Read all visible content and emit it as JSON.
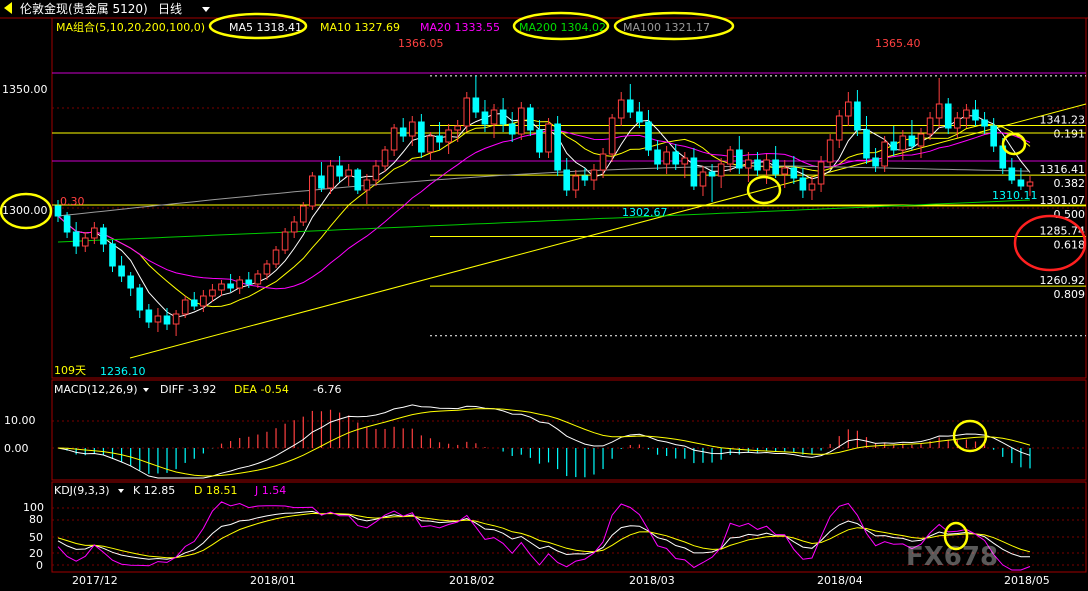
{
  "header": {
    "back_icon": "left-triangle-icon",
    "instrument": "伦敦金现(贵金属 5120)",
    "period": "日线",
    "dropdown_icon": "chevron-down-icon"
  },
  "ma_legend": {
    "label": "MA组合(5,10,20,200,100,0)",
    "items": [
      {
        "text": "MA5 1318.41",
        "color": "#ffffff"
      },
      {
        "text": "MA10 1327.69",
        "color": "#ffff00"
      },
      {
        "text": "MA20 1333.55",
        "color": "#ff00ff"
      },
      {
        "text": "MA200 1304.02",
        "color": "#00cc00"
      },
      {
        "text": "MA100 1321.17",
        "color": "#999999"
      }
    ]
  },
  "price_axis": {
    "ticks": [
      "1350.00",
      "1300.00"
    ],
    "min": 1225,
    "max": 1375
  },
  "annotations": {
    "high_left": "1366.05",
    "high_right": "1365.40",
    "low_left": "1236.10",
    "low_mid": "1302.67",
    "low_right": "1310.11",
    "left_partial": "0.30",
    "days": "109天"
  },
  "fib_levels": [
    {
      "price": "1341.23",
      "ratio": "0.191"
    },
    {
      "price": "1316.41",
      "ratio": "0.382"
    },
    {
      "price": "1301.07",
      "ratio": "0.500"
    },
    {
      "price": "1285.74",
      "ratio": "0.618"
    },
    {
      "price": "1260.92",
      "ratio": "0.809"
    }
  ],
  "macd_legend": {
    "label": "MACD(12,26,9)",
    "diff": "DIFF -3.92",
    "dea": "DEA -0.54",
    "macd": "-6.76",
    "ticks": [
      "10.00",
      "0.00"
    ]
  },
  "kdj_legend": {
    "label": "KDJ(9,3,3)",
    "k": "K 12.85",
    "d": "D 18.51",
    "j": "J 1.54",
    "ticks": [
      "100",
      "80",
      "50",
      "20",
      "0"
    ]
  },
  "time_axis": [
    "2017/12",
    "2018/01",
    "2018/02",
    "2018/03",
    "2018/04",
    "2018/05"
  ],
  "watermark": "FX678",
  "colors": {
    "up": "#ff4040",
    "down": "#00ffff",
    "ma5": "#ffffff",
    "ma10": "#ffff00",
    "ma20": "#ff00ff",
    "ma200": "#00cc00",
    "ma100": "#9a9a9a",
    "fib": "#ffff00",
    "highlight": "#ffff00",
    "circle_red": "#ff2020",
    "grid": "#7a0000"
  },
  "chart_data": {
    "type": "candlestick",
    "ohlc": [
      [
        1301,
        1304,
        1293,
        1296
      ],
      [
        1296,
        1298,
        1285,
        1288
      ],
      [
        1288,
        1293,
        1277,
        1281
      ],
      [
        1281,
        1288,
        1278,
        1285
      ],
      [
        1285,
        1293,
        1282,
        1290
      ],
      [
        1290,
        1292,
        1278,
        1282
      ],
      [
        1282,
        1284,
        1268,
        1271
      ],
      [
        1271,
        1276,
        1263,
        1266
      ],
      [
        1266,
        1268,
        1256,
        1260
      ],
      [
        1260,
        1262,
        1245,
        1249
      ],
      [
        1249,
        1252,
        1240,
        1243
      ],
      [
        1243,
        1250,
        1238,
        1246
      ],
      [
        1246,
        1250,
        1239,
        1242
      ],
      [
        1242,
        1249,
        1236,
        1247
      ],
      [
        1247,
        1256,
        1245,
        1254
      ],
      [
        1254,
        1258,
        1249,
        1251
      ],
      [
        1251,
        1259,
        1248,
        1256
      ],
      [
        1256,
        1262,
        1253,
        1259
      ],
      [
        1259,
        1264,
        1256,
        1262
      ],
      [
        1262,
        1267,
        1258,
        1260
      ],
      [
        1260,
        1266,
        1257,
        1264
      ],
      [
        1264,
        1268,
        1260,
        1262
      ],
      [
        1262,
        1269,
        1260,
        1267
      ],
      [
        1267,
        1274,
        1264,
        1272
      ],
      [
        1272,
        1281,
        1270,
        1279
      ],
      [
        1279,
        1290,
        1277,
        1288
      ],
      [
        1288,
        1296,
        1285,
        1293
      ],
      [
        1293,
        1303,
        1291,
        1301
      ],
      [
        1301,
        1318,
        1299,
        1316
      ],
      [
        1316,
        1323,
        1308,
        1310
      ],
      [
        1310,
        1324,
        1307,
        1321
      ],
      [
        1321,
        1326,
        1313,
        1316
      ],
      [
        1316,
        1322,
        1311,
        1319
      ],
      [
        1319,
        1320,
        1307,
        1309
      ],
      [
        1309,
        1317,
        1302,
        1314
      ],
      [
        1314,
        1324,
        1311,
        1321
      ],
      [
        1321,
        1331,
        1318,
        1329
      ],
      [
        1329,
        1342,
        1326,
        1340
      ],
      [
        1340,
        1345,
        1333,
        1336
      ],
      [
        1336,
        1346,
        1331,
        1343
      ],
      [
        1343,
        1347,
        1325,
        1328
      ],
      [
        1328,
        1338,
        1324,
        1336
      ],
      [
        1336,
        1343,
        1329,
        1333
      ],
      [
        1333,
        1342,
        1327,
        1339
      ],
      [
        1339,
        1344,
        1333,
        1341
      ],
      [
        1341,
        1358,
        1338,
        1355
      ],
      [
        1355,
        1366,
        1345,
        1348
      ],
      [
        1348,
        1354,
        1338,
        1342
      ],
      [
        1342,
        1352,
        1335,
        1349
      ],
      [
        1349,
        1355,
        1338,
        1342
      ],
      [
        1342,
        1348,
        1333,
        1337
      ],
      [
        1337,
        1353,
        1334,
        1350
      ],
      [
        1350,
        1352,
        1336,
        1339
      ],
      [
        1339,
        1344,
        1325,
        1328
      ],
      [
        1328,
        1345,
        1325,
        1342
      ],
      [
        1342,
        1346,
        1316,
        1319
      ],
      [
        1319,
        1325,
        1306,
        1309
      ],
      [
        1309,
        1319,
        1305,
        1316
      ],
      [
        1316,
        1320,
        1311,
        1314
      ],
      [
        1314,
        1322,
        1309,
        1319
      ],
      [
        1319,
        1330,
        1315,
        1327
      ],
      [
        1327,
        1347,
        1323,
        1345
      ],
      [
        1345,
        1358,
        1341,
        1354
      ],
      [
        1354,
        1362,
        1345,
        1348
      ],
      [
        1348,
        1353,
        1340,
        1343
      ],
      [
        1343,
        1349,
        1326,
        1329
      ],
      [
        1329,
        1334,
        1319,
        1322
      ],
      [
        1322,
        1331,
        1317,
        1328
      ],
      [
        1328,
        1332,
        1319,
        1322
      ],
      [
        1322,
        1328,
        1315,
        1325
      ],
      [
        1325,
        1330,
        1309,
        1311
      ],
      [
        1311,
        1321,
        1306,
        1318
      ],
      [
        1318,
        1322,
        1303,
        1316
      ],
      [
        1316,
        1325,
        1310,
        1322
      ],
      [
        1322,
        1331,
        1318,
        1329
      ],
      [
        1329,
        1336,
        1317,
        1320
      ],
      [
        1320,
        1328,
        1313,
        1324
      ],
      [
        1324,
        1328,
        1316,
        1319
      ],
      [
        1319,
        1327,
        1312,
        1324
      ],
      [
        1324,
        1331,
        1315,
        1317
      ],
      [
        1317,
        1324,
        1310,
        1320
      ],
      [
        1320,
        1326,
        1312,
        1315
      ],
      [
        1315,
        1320,
        1305,
        1309
      ],
      [
        1309,
        1316,
        1304,
        1312
      ],
      [
        1312,
        1326,
        1308,
        1323
      ],
      [
        1323,
        1337,
        1320,
        1334
      ],
      [
        1334,
        1349,
        1330,
        1346
      ],
      [
        1346,
        1358,
        1341,
        1353
      ],
      [
        1353,
        1359,
        1336,
        1339
      ],
      [
        1339,
        1346,
        1322,
        1325
      ],
      [
        1325,
        1330,
        1318,
        1321
      ],
      [
        1321,
        1336,
        1318,
        1333
      ],
      [
        1333,
        1341,
        1326,
        1329
      ],
      [
        1329,
        1339,
        1324,
        1336
      ],
      [
        1336,
        1344,
        1329,
        1331
      ],
      [
        1331,
        1340,
        1325,
        1337
      ],
      [
        1337,
        1348,
        1334,
        1345
      ],
      [
        1345,
        1365,
        1340,
        1352
      ],
      [
        1352,
        1355,
        1337,
        1340
      ],
      [
        1340,
        1348,
        1335,
        1345
      ],
      [
        1345,
        1352,
        1340,
        1349
      ],
      [
        1349,
        1354,
        1341,
        1344
      ],
      [
        1344,
        1348,
        1337,
        1341
      ],
      [
        1341,
        1345,
        1328,
        1331
      ],
      [
        1331,
        1335,
        1317,
        1320
      ],
      [
        1320,
        1325,
        1312,
        1314
      ],
      [
        1314,
        1320,
        1309,
        1311
      ],
      [
        1311,
        1316,
        1306,
        1313
      ]
    ],
    "series": [
      {
        "name": "MA5",
        "value": 1318.41
      },
      {
        "name": "MA10",
        "value": 1327.69
      },
      {
        "name": "MA20",
        "value": 1333.55
      },
      {
        "name": "MA200",
        "value": 1304.02
      },
      {
        "name": "MA100",
        "value": 1321.17
      }
    ],
    "ylim": [
      1225,
      1375
    ],
    "grid": true
  }
}
